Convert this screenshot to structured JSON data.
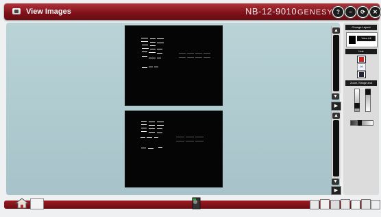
{
  "window": {
    "title": "View Images",
    "model": "NB-12-9010",
    "brand": "GENESYS"
  },
  "window_buttons": [
    {
      "name": "help-button",
      "glyph": "?"
    },
    {
      "name": "minimize-button",
      "glyph": "–"
    },
    {
      "name": "settings-button",
      "glyph": "⟳"
    },
    {
      "name": "close-button",
      "glyph": "✕"
    }
  ],
  "right_panel": {
    "change_layout": {
      "header": "Change Layout",
      "option_label": "View All"
    },
    "link": {
      "header": "Link"
    },
    "dgg": {
      "header": "Zoom, Range and Gamma"
    }
  },
  "scroll": {
    "up": "▲",
    "down": "▼",
    "next": "▶"
  },
  "colors": {
    "brand_red": "#7d1018",
    "panel_bg": "#aec8cd",
    "gel_bg": "#050505"
  }
}
